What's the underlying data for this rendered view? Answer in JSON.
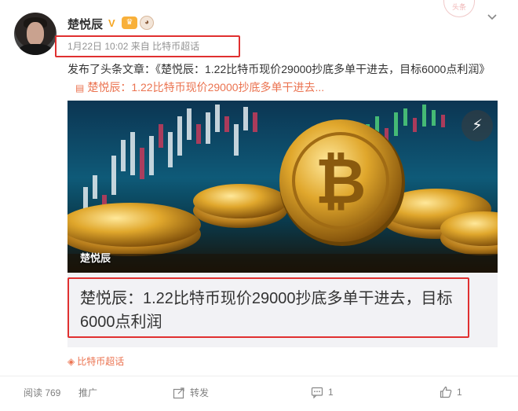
{
  "user": {
    "name": "楚悦辰",
    "verified_badge": "V",
    "badge_colors": {
      "vip": "#f8b03a",
      "monkey": "#d8b89c"
    }
  },
  "meta": {
    "time": "1月22日 10:02",
    "source": "来自 比特币超话"
  },
  "post": {
    "text": "发布了头条文章：《楚悦辰：1.22比特币现价29000抄底多单干进去，目标6000点利润》",
    "link_text": "楚悦辰：1.22比特币现价29000抄底多单干进去..."
  },
  "article": {
    "image_caption": "楚悦辰",
    "title": "楚悦辰：1.22比特币现价29000抄底多单干进去，目标6000点利润"
  },
  "topic": {
    "label": "比特币超话"
  },
  "footer": {
    "read": "阅读 769",
    "promote": "推广",
    "share": "转发",
    "comment": "1",
    "like": "1"
  },
  "colors": {
    "accent": "#eb7350",
    "highlight_border": "#e03030",
    "meta_gray": "#939393"
  }
}
